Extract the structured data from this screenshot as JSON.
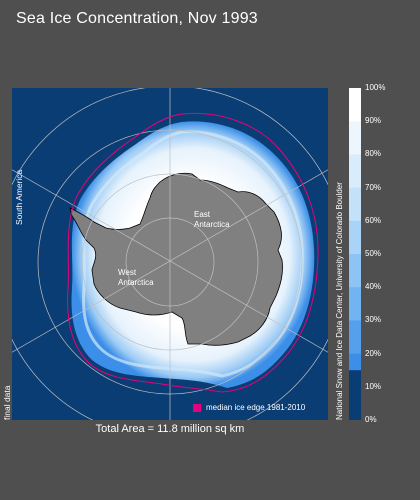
{
  "title": "Sea Ice Concentration, Nov 1993",
  "map": {
    "labels": {
      "south_america": "South America",
      "east_antarctica": "East\nAntarctica",
      "west_antarctica": "West\nAntarctica"
    },
    "status_label": "final data",
    "total_area": "Total Area = 11.8 million sq km",
    "legend_label": "median ice edge 1981-2010",
    "colors": {
      "ocean": "#0b3d75",
      "land": "#808080",
      "ice_high": "#ffffff",
      "ice_mid": "#d8ecfb",
      "ice_low": "#3c8fe8",
      "median_edge": "#e6007e",
      "grid": "#bfbfbf"
    }
  },
  "colorbar": {
    "ticks": [
      "100%",
      "90%",
      "80%",
      "70%",
      "60%",
      "50%",
      "40%",
      "30%",
      "20%",
      "10%",
      "0%"
    ],
    "colors": [
      "#ffffff",
      "#eef6fd",
      "#d9ecfb",
      "#c3e1f9",
      "#a9d3f7",
      "#8ec4f4",
      "#72b3f1",
      "#569fed",
      "#3c8fe8",
      "#2a7fe0",
      "#0b3d75"
    ]
  },
  "credit": "National Snow and Ice Data Center, University of Colorado Boulder"
}
